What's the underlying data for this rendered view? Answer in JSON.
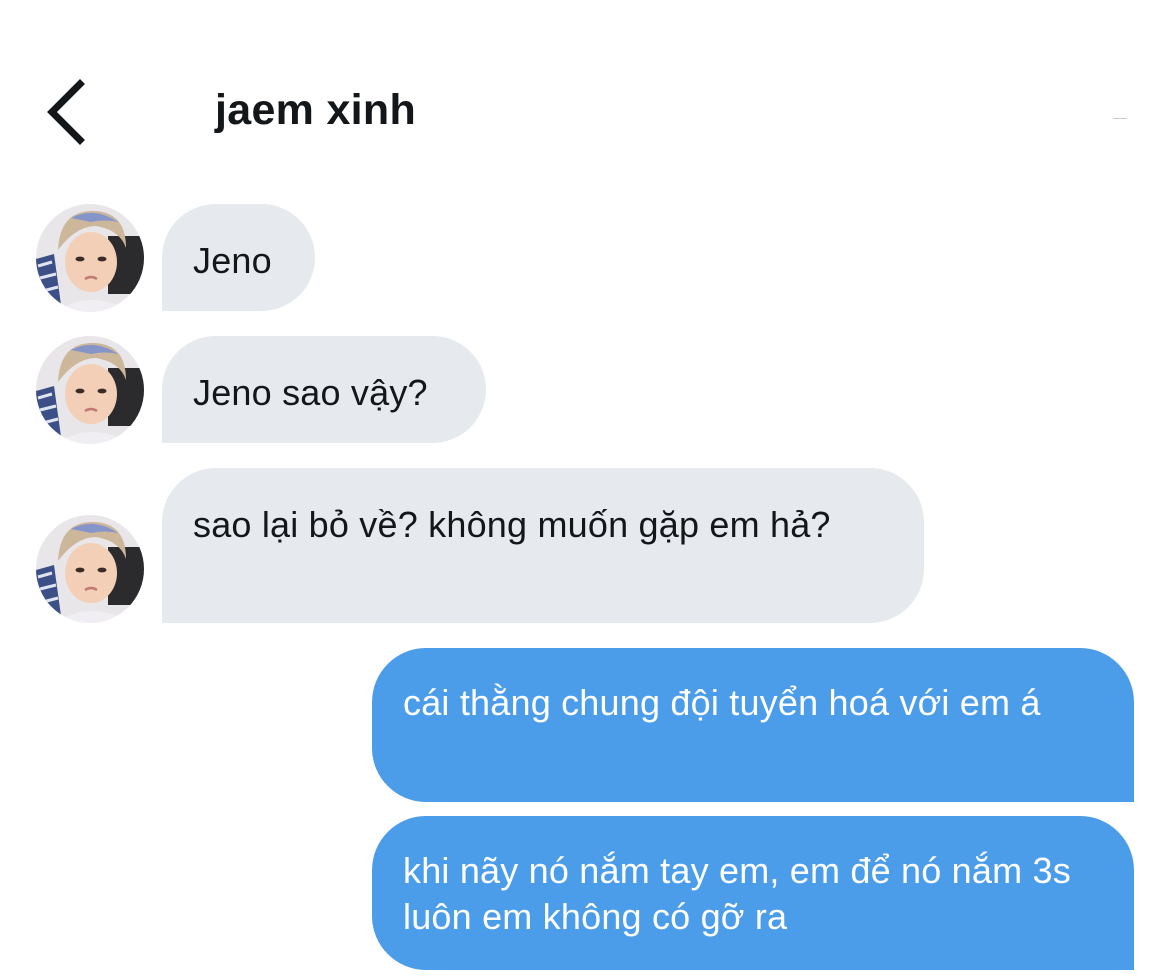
{
  "header": {
    "back_icon": "chevron-left-icon",
    "title": "jaem xinh"
  },
  "colors": {
    "incoming_bubble": "#e6eaee",
    "outgoing_bubble": "#4b9dea",
    "text_dark": "#14171a",
    "text_light": "#ffffff"
  },
  "messages": [
    {
      "direction": "incoming",
      "text": "Jeno"
    },
    {
      "direction": "incoming",
      "text": "Jeno sao vậy?"
    },
    {
      "direction": "incoming",
      "text": "sao lại bỏ về? không muốn gặp em hả?"
    },
    {
      "direction": "outgoing",
      "text": "cái thằng chung đội tuyển hoá với em á"
    },
    {
      "direction": "outgoing",
      "text": "khi nãy nó nắm tay em, em để nó nắm 3s luôn em không có gỡ ra"
    }
  ]
}
